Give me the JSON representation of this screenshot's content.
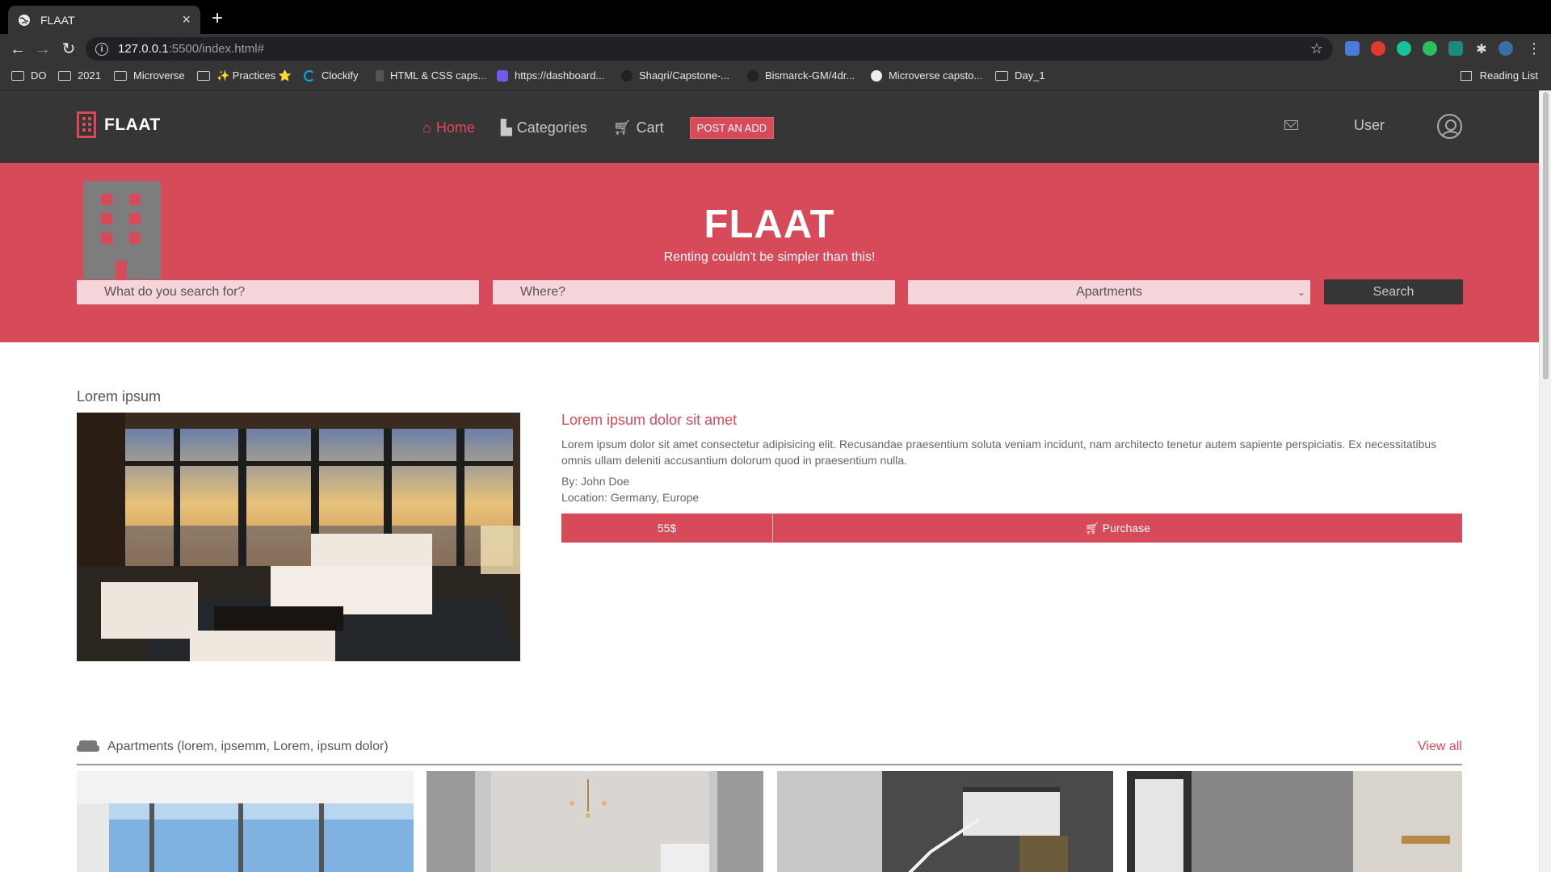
{
  "browser": {
    "tab_title": "FLAAT",
    "new_tab": "+",
    "url_host": "127.0.0.1",
    "url_rest": ":5500/index.html#",
    "bookmarks": [
      {
        "label": "DO",
        "icon": "folder-icon"
      },
      {
        "label": "2021",
        "icon": "folder-icon"
      },
      {
        "label": "Microverse",
        "icon": "folder-icon"
      },
      {
        "label": "✨ Practices ⭐",
        "icon": "folder-icon"
      },
      {
        "label": "Clockify",
        "icon": "clockify-icon"
      },
      {
        "label": "HTML & CSS caps...",
        "icon": "doc-icon"
      },
      {
        "label": "https://dashboard...",
        "icon": "dashboard-icon"
      },
      {
        "label": "Shaqri/Capstone-...",
        "icon": "github-icon"
      },
      {
        "label": "Bismarck-GM/4dr...",
        "icon": "github-icon"
      },
      {
        "label": "Microverse capsto...",
        "icon": "globe-icon"
      },
      {
        "label": "Day_1",
        "icon": "folder-icon"
      }
    ],
    "reading_list": "Reading List"
  },
  "header": {
    "brand": "FLAAT",
    "nav": [
      {
        "label": "Home",
        "icon": "home-icon",
        "active": true
      },
      {
        "label": "Categories",
        "icon": "puzzle-icon",
        "active": false
      },
      {
        "label": "Cart",
        "icon": "cart-icon",
        "active": false
      }
    ],
    "post_button": "POST AN ADD",
    "user_label": "User"
  },
  "hero": {
    "title": "FLAAT",
    "subtitle": "Renting couldn't be simpler than this!",
    "search_placeholder": "What do you search for?",
    "where_placeholder": "Where?",
    "category_selected": "Apartments",
    "search_button": "Search"
  },
  "featured": {
    "heading": "Lorem ipsum",
    "title": "Lorem ipsum dolor sit amet",
    "description": "Lorem ipsum dolor sit amet consectetur adipisicing elit. Recusandae praesentium soluta veniam incidunt, nam architecto tenetur autem sapiente perspiciatis. Ex necessitatibus omnis ullam deleniti accusantium dolorum quod in praesentium nulla.",
    "by": "By: John Doe",
    "location": "Location: Germany, Europe",
    "price": "55$",
    "purchase_label": "Purchase"
  },
  "apartments": {
    "heading": "Apartments (lorem, ipsemm, Lorem, ipsum dolor)",
    "view_all": "View all"
  },
  "colors": {
    "accent": "#d64a5a",
    "header_bg": "#363636"
  }
}
